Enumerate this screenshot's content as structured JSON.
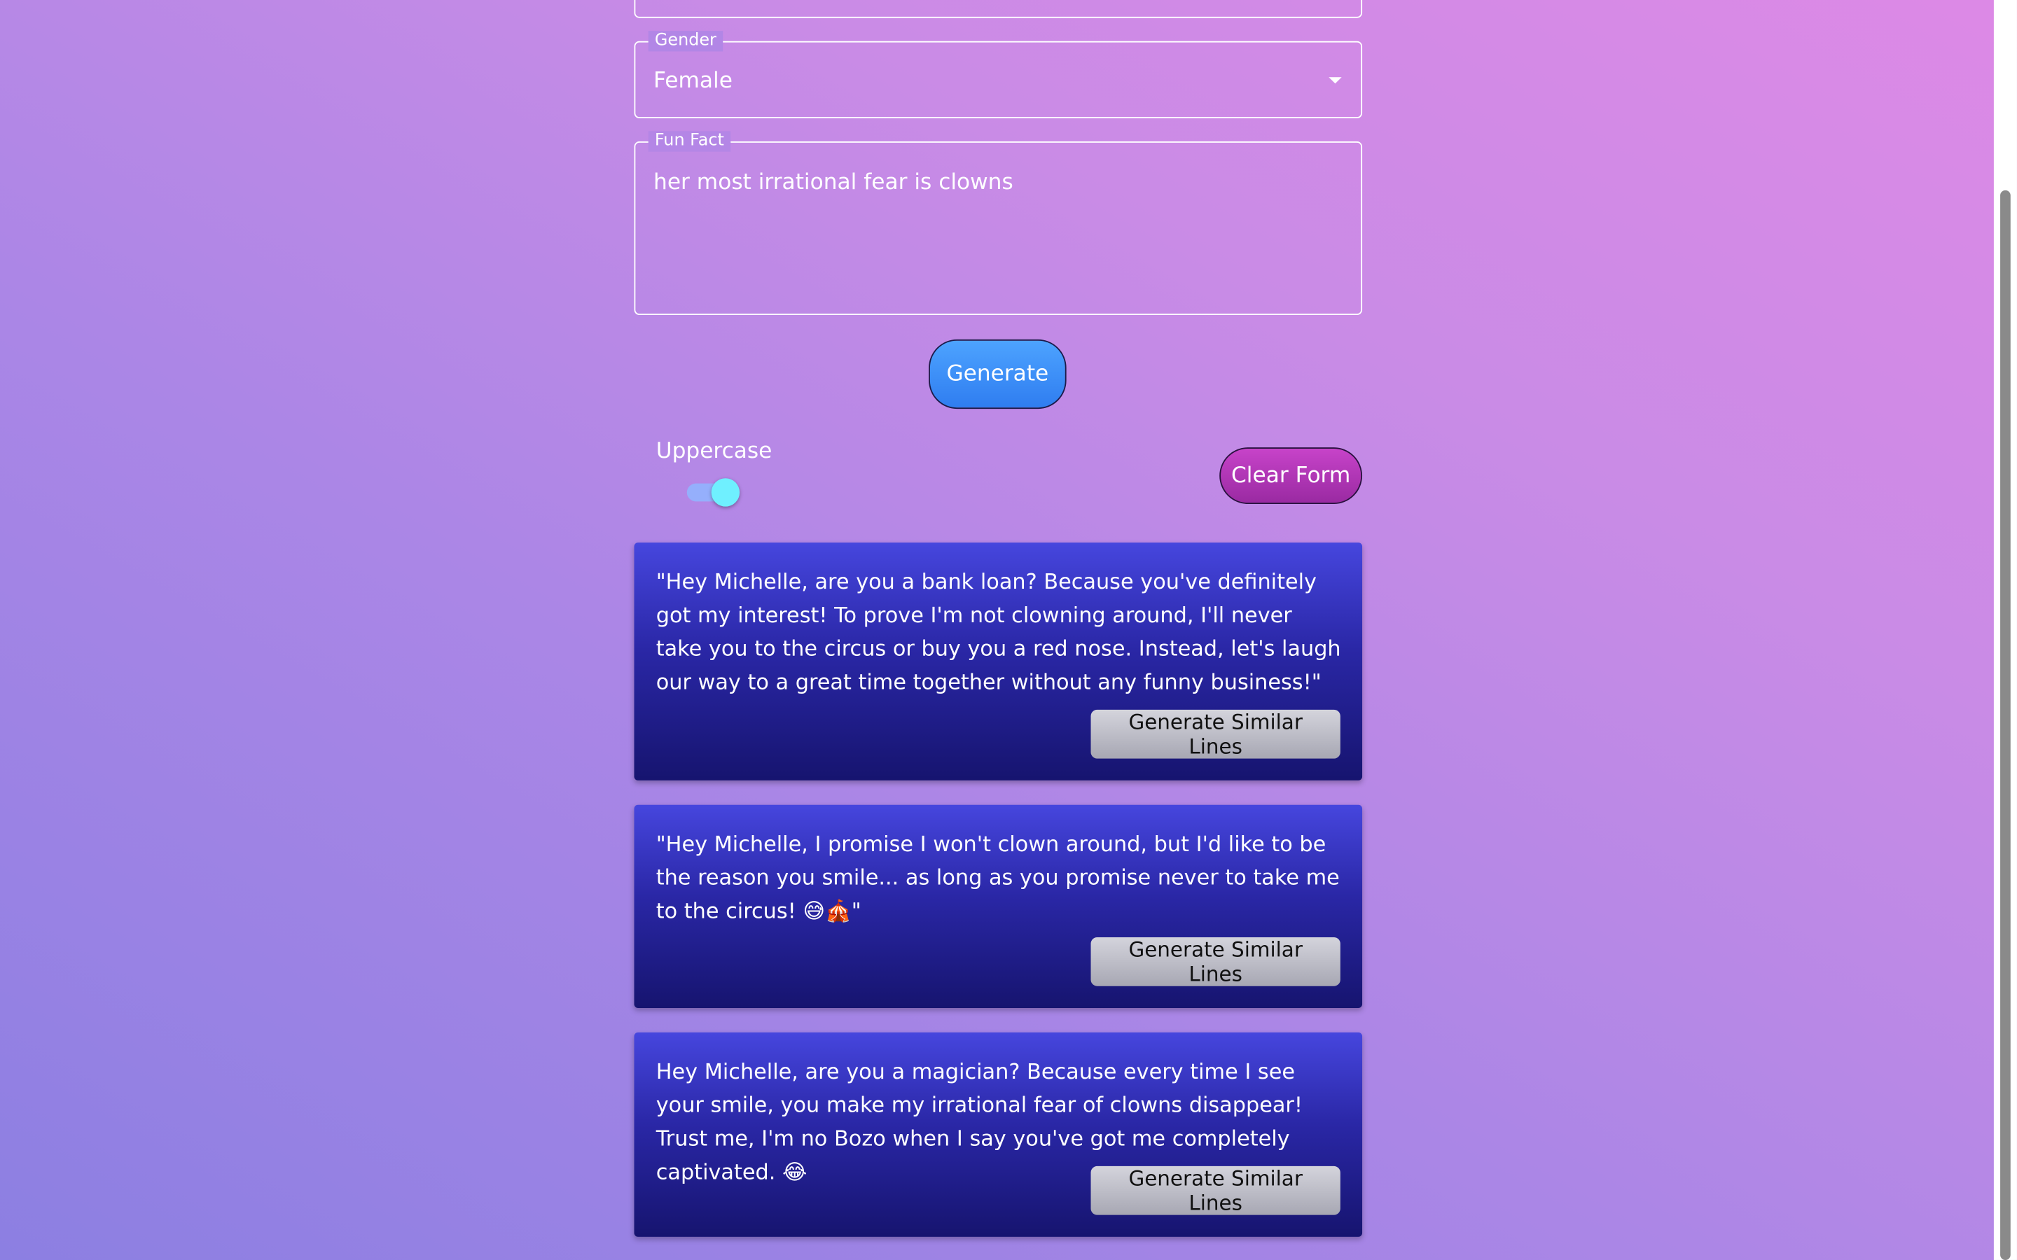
{
  "form": {
    "gender": {
      "label": "Gender",
      "value": "Female"
    },
    "fun_fact": {
      "label": "Fun Fact",
      "value": "her most irrational fear is clowns"
    },
    "generate_label": "Generate",
    "uppercase": {
      "label": "Uppercase",
      "on": true
    },
    "clear_label": "Clear Form"
  },
  "results": [
    {
      "text": "\"Hey Michelle, are you a bank loan? Because you've definitely got my interest! To prove I'm not clowning around, I'll never take you to the circus or buy you a red nose. Instead, let's laugh our way to a great time together without any funny business!\"",
      "button_label": "Generate Similar Lines"
    },
    {
      "text": "\"Hey Michelle, I promise I won't clown around, but I'd like to be the reason you smile... as long as you promise never to take me to the circus! 😅🎪\"",
      "button_label": "Generate Similar Lines"
    },
    {
      "text": "Hey Michelle, are you a magician? Because every time I see your smile, you make my irrational fear of clowns disappear! Trust me, I'm no Bozo when I say you've got me completely captivated. 😂",
      "button_label": "Generate Similar Lines"
    }
  ],
  "colors": {
    "generate_button": "#2f7df0",
    "clear_button": "#b238b8",
    "card": "#2a27a6",
    "toggle_knob": "#6ff0ff"
  }
}
